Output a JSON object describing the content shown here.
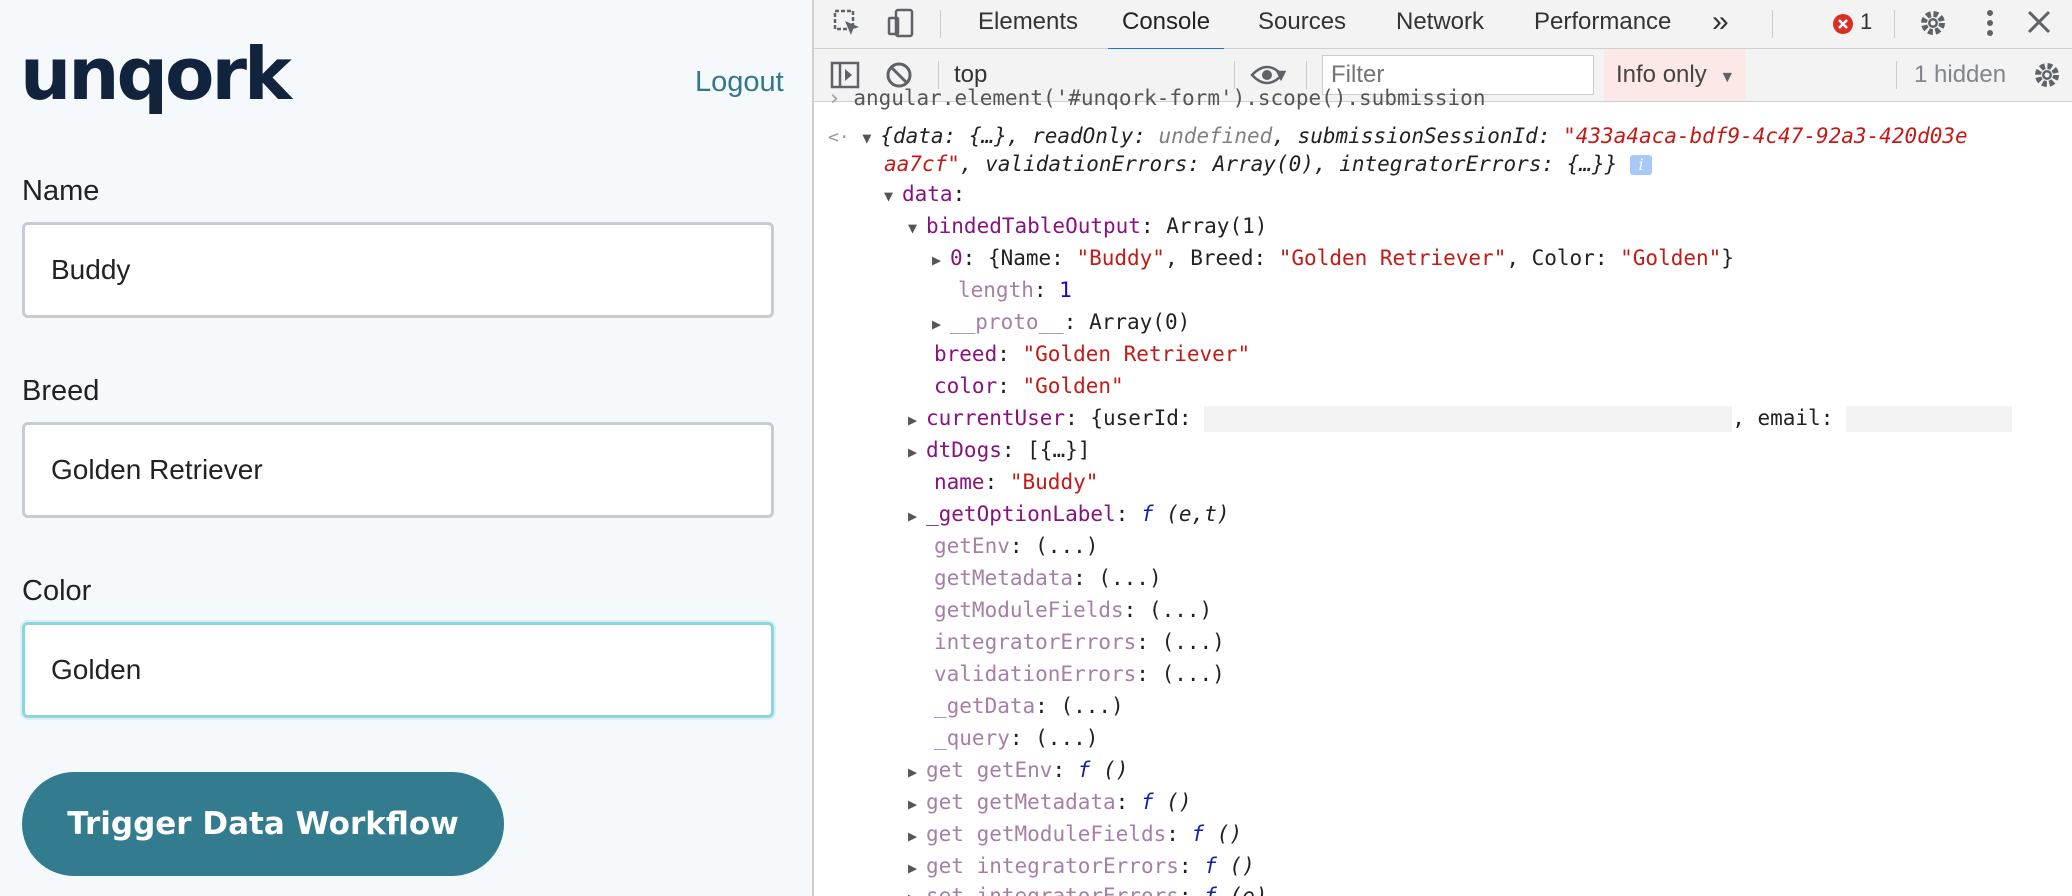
{
  "form": {
    "logo": "unqork",
    "logout": "Logout",
    "fields": [
      {
        "label": "Name",
        "value": "Buddy"
      },
      {
        "label": "Breed",
        "value": "Golden Retriever"
      },
      {
        "label": "Color",
        "value": "Golden"
      }
    ],
    "button": "Trigger Data Workflow"
  },
  "devtools": {
    "tabs": [
      "Elements",
      "Console",
      "Sources",
      "Network",
      "Performance"
    ],
    "more_tabs": "»",
    "error_count": "1",
    "context": "top",
    "filter_placeholder": "Filter",
    "levels": "Info only",
    "hidden": "1 hidden",
    "command": "angular.element('#unqork-form').scope().submission"
  },
  "console": {
    "summary": {
      "data": "{…}",
      "readOnly": "undefined",
      "sessionId_a": "\"433a4aca-bdf9-4c47-92a3-420d03e",
      "sessionId_b": "aa7cf\"",
      "validationErrors": "Array(0)",
      "integratorErrors": "{…}}"
    },
    "binded_type": "Array(1)",
    "item0": {
      "name": "\"Buddy\"",
      "breed": "\"Golden Retriever\"",
      "color": "\"Golden\""
    },
    "length": "1",
    "proto": "Array(0)",
    "breed": "\"Golden Retriever\"",
    "color": "\"Golden\"",
    "currentUser_prefix": "{userId:",
    "currentUser_email": ", email:",
    "dtDogs": "[{…}]",
    "name": "\"Buddy\"",
    "getOptionLabel": "(e,t)",
    "getters": [
      "getEnv",
      "getMetadata",
      "getModuleFields",
      "integratorErrors",
      "validationErrors",
      "_getData",
      "_query"
    ],
    "lazy": "(...)",
    "accessors": [
      {
        "kw": "get",
        "name": "getEnv",
        "args": "()"
      },
      {
        "kw": "get",
        "name": "getMetadata",
        "args": "()"
      },
      {
        "kw": "get",
        "name": "getModuleFields",
        "args": "()"
      },
      {
        "kw": "get",
        "name": "integratorErrors",
        "args": "()"
      },
      {
        "kw": "set",
        "name": "integratorErrors",
        "args": "(e)"
      }
    ]
  }
}
